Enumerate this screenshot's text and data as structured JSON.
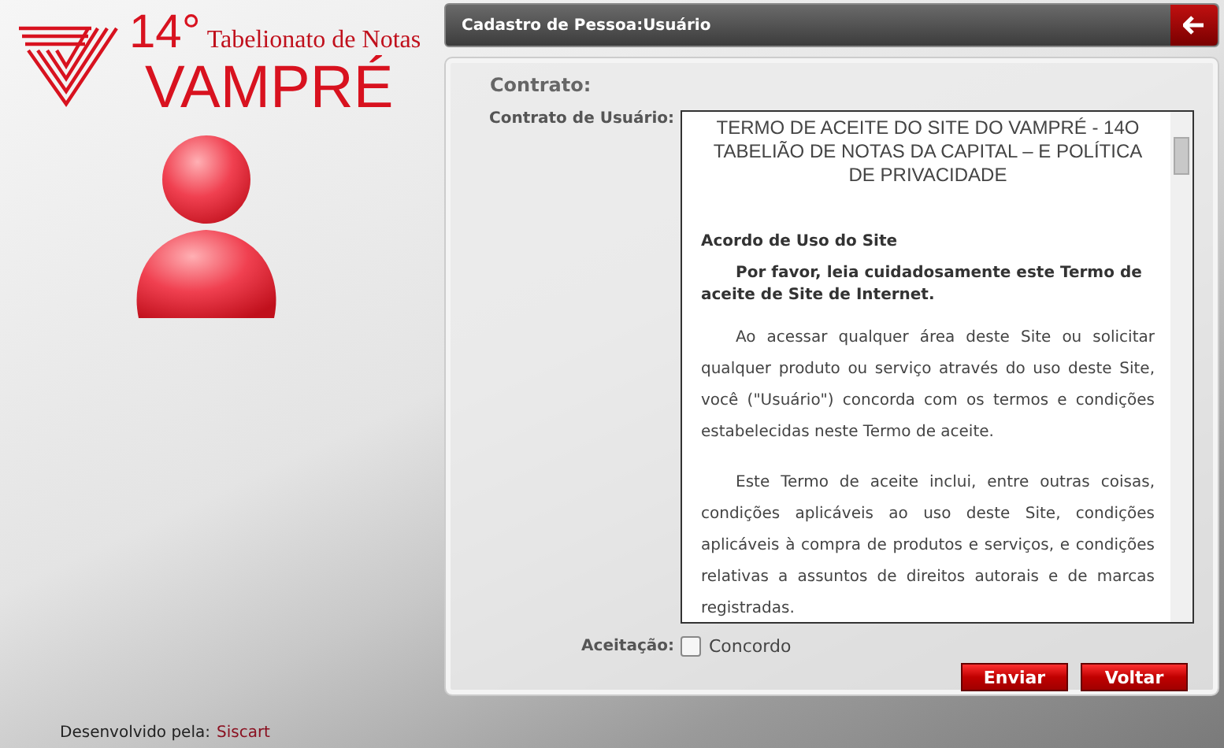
{
  "logo": {
    "number": "14°",
    "subtitle": "Tabelionato de Notas",
    "name": "VAMPRÉ"
  },
  "footer": {
    "label": "Desenvolvido pela:",
    "link": "Siscart"
  },
  "window": {
    "title": "Cadastro de Pessoa:Usuário"
  },
  "form": {
    "section_title": "Contrato:",
    "contract_label": "Contrato de Usuário:",
    "contract": [
      {
        "kind": "title",
        "text": "TERMO DE ACEITE DO SITE DO VAMPRÉ - 14O TABELIÃO DE NOTAS DA CAPITAL – E POLÍTICA DE PRIVACIDADE"
      },
      {
        "kind": "heading",
        "text": "Acordo de Uso do Site"
      },
      {
        "kind": "strong",
        "text": "Por favor, leia cuidadosamente este Termo de aceite de Site de Internet."
      },
      {
        "kind": "body",
        "text": "Ao acessar qualquer área deste Site ou solicitar qualquer produto ou serviço através do uso deste Site, você (\"Usuário\") concorda com os termos e condições estabelecidas neste Termo de aceite."
      },
      {
        "kind": "body",
        "text": "Este Termo de aceite inclui, entre outras coisas, condições aplicáveis ao uso deste Site, condições aplicáveis à compra de produtos e serviços, e condições relativas a assuntos de direitos autorais e de marcas registradas."
      }
    ],
    "acceptance_label": "Aceitação:",
    "agree": {
      "label": "Concordo",
      "checked": false
    },
    "buttons": [
      "Enviar",
      "Voltar"
    ]
  }
}
